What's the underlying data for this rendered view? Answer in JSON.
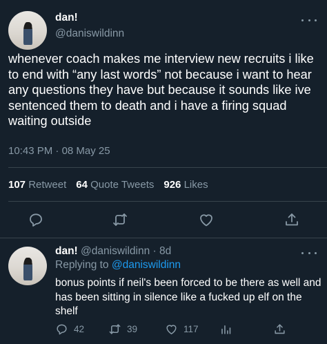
{
  "main_tweet": {
    "author_name": "dan!",
    "author_handle": "@daniswildinn",
    "text": "whenever coach makes me interview new recruits i like to end with “any last words” not because i want to hear any questions they have but because it sounds like ive sentenced them to death and i have a firing squad waiting outside",
    "time": "10:43 PM",
    "separator": "·",
    "date": "08 May 25",
    "stats": {
      "retweets_count": "107",
      "retweets_label": "Retweet",
      "quotes_count": "64",
      "quotes_label": "Quote Tweets",
      "likes_count": "926",
      "likes_label": "Likes"
    },
    "actions": [
      "reply-icon",
      "retweet-icon",
      "like-icon",
      "share-icon"
    ],
    "more_icon": "more-horizontal-icon"
  },
  "reply_tweet": {
    "author_name": "dan!",
    "author_handle": "@daniswildinn",
    "separator": "·",
    "age": "8d",
    "replying_prefix": "Replying to",
    "replying_to": "@daniswildinn",
    "text": "bonus points if neil's been forced to be there as well and has been sitting in silence like a fucked up elf on the shelf",
    "counts": {
      "replies": "42",
      "retweets": "39",
      "likes": "117"
    },
    "actions": [
      "reply-icon",
      "retweet-icon",
      "like-icon",
      "analytics-icon",
      "share-icon"
    ]
  },
  "colors": {
    "background": "#15202b",
    "text_primary": "#ffffff",
    "text_secondary": "#8899a6",
    "divider": "#38444d",
    "accent": "#1d9bf0"
  }
}
